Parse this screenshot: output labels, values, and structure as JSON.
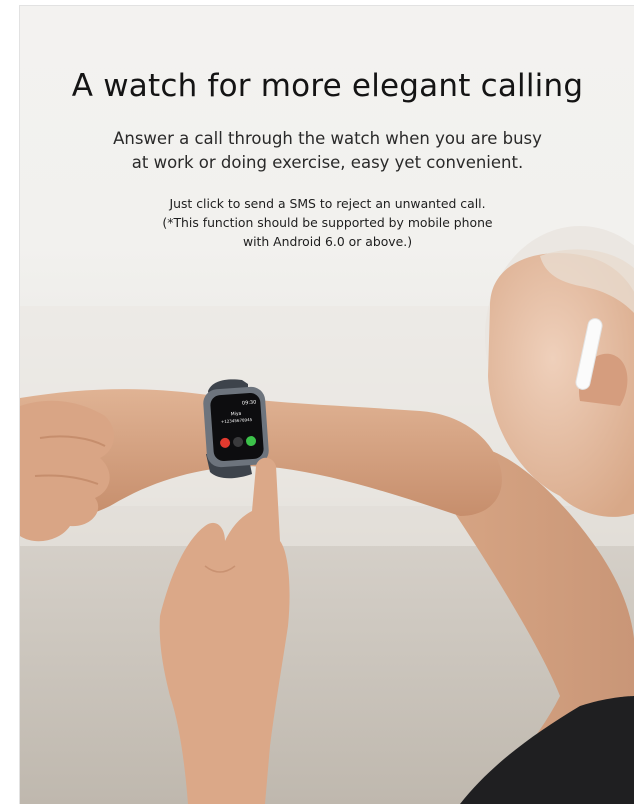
{
  "headline": "A watch for more elegant calling",
  "subhead": {
    "line1": "Answer a call through the watch when you are busy",
    "line2": "at work or doing exercise, easy yet convenient."
  },
  "note": {
    "line1": "Just click to send a SMS to reject an unwanted call.",
    "line2": "(*This function should be supported by mobile phone",
    "line3": "with Android 6.0 or above.)"
  },
  "watch_screen": {
    "time": "09:30",
    "caller_name": "Miya",
    "caller_number": "+12345678945"
  },
  "colors": {
    "background": "#f2f1ee",
    "headline_text": "#141414",
    "skin": "#d9a585",
    "watch_strap": "#3d434b",
    "decline_button": "#e23a2f",
    "answer_button": "#3cc24a"
  },
  "icons": {
    "decline": "phone-decline-icon",
    "message": "message-icon",
    "answer": "phone-answer-icon"
  }
}
